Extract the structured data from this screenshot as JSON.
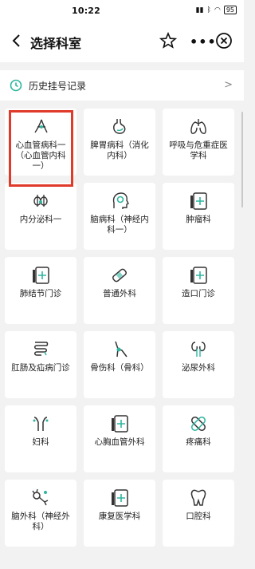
{
  "status": {
    "time": "10:22",
    "battery": "95"
  },
  "header": {
    "title": "选择科室"
  },
  "history": {
    "label": "历史挂号记录"
  },
  "departments": [
    {
      "name": "心血管病科一（心血管内科一）",
      "icon": "heart-vessel"
    },
    {
      "name": "脾胃病科（消化内科）",
      "icon": "stomach"
    },
    {
      "name": "呼吸与危重症医学科",
      "icon": "lungs"
    },
    {
      "name": "内分泌科一",
      "icon": "thyroid"
    },
    {
      "name": "脑病科（神经内科一）",
      "icon": "brain-head"
    },
    {
      "name": "肿瘤科",
      "icon": "clinic-door"
    },
    {
      "name": "肺结节门诊",
      "icon": "clinic-door"
    },
    {
      "name": "普通外科",
      "icon": "bandage"
    },
    {
      "name": "造口门诊",
      "icon": "clinic-door"
    },
    {
      "name": "肛肠及疝病门诊",
      "icon": "intestine"
    },
    {
      "name": "骨伤科（骨科）",
      "icon": "bone-joint"
    },
    {
      "name": "泌尿外科",
      "icon": "kidney"
    },
    {
      "name": "妇科",
      "icon": "uterus"
    },
    {
      "name": "心胸血管外科",
      "icon": "clinic-door"
    },
    {
      "name": "疼痛科",
      "icon": "bandage-cross"
    },
    {
      "name": "脑外科（神经外科）",
      "icon": "neuron"
    },
    {
      "name": "康复医学科",
      "icon": "clinic-door"
    },
    {
      "name": "口腔科",
      "icon": "tooth"
    }
  ],
  "colors": {
    "accent": "#2fb5a0",
    "highlight": "#e03a2a"
  }
}
